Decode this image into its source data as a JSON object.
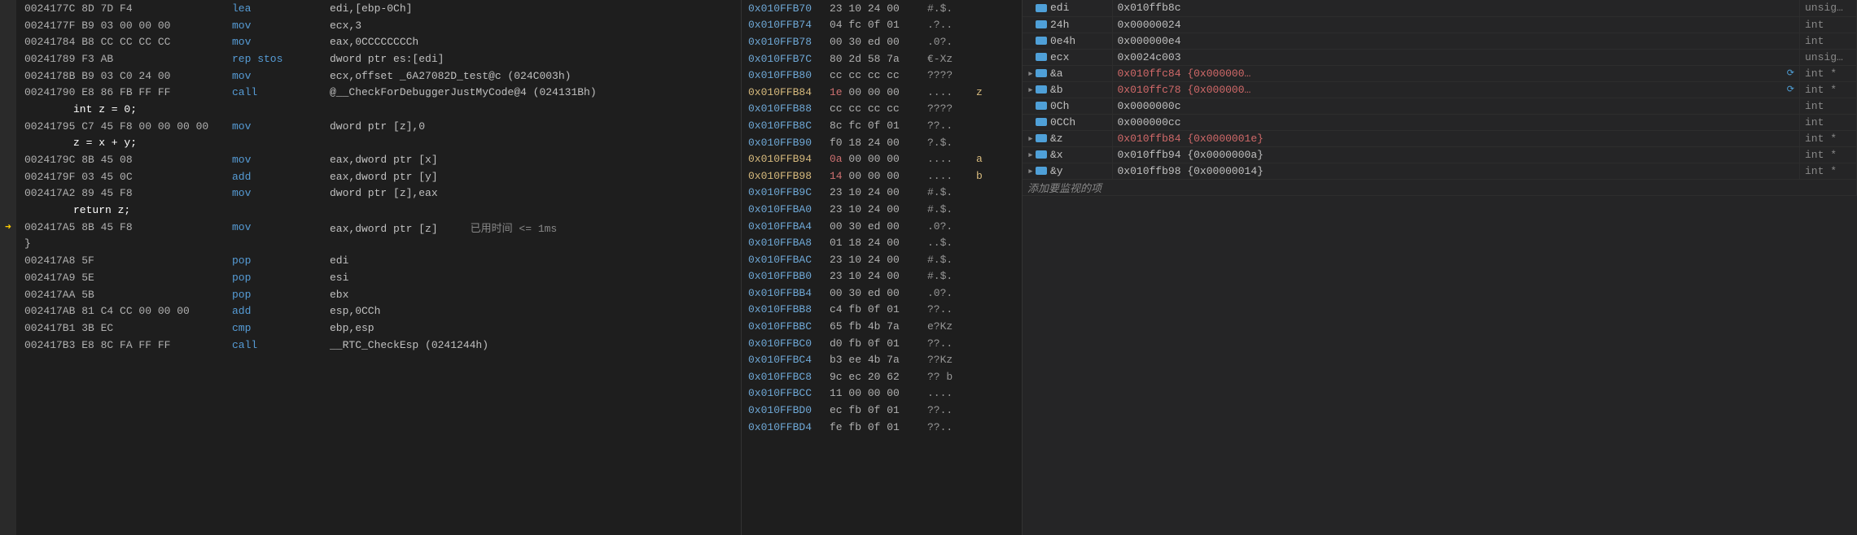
{
  "asm": [
    {
      "type": "asm",
      "addr": "0024177C 8D 7D F4",
      "op": "lea",
      "args": "edi,[ebp-0Ch]"
    },
    {
      "type": "asm",
      "addr": "0024177F B9 03 00 00 00",
      "op": "mov",
      "args": "ecx,3"
    },
    {
      "type": "asm",
      "addr": "00241784 B8 CC CC CC CC",
      "op": "mov",
      "args": "eax,0CCCCCCCCh"
    },
    {
      "type": "asm",
      "addr": "00241789 F3 AB",
      "op": "rep stos",
      "args": "dword ptr es:[edi]"
    },
    {
      "type": "asm",
      "addr": "0024178B B9 03 C0 24 00",
      "op": "mov",
      "args": "ecx,offset _6A27082D_test@c (024C003h)"
    },
    {
      "type": "asm",
      "addr": "00241790 E8 86 FB FF FF",
      "op": "call",
      "args": "@__CheckForDebuggerJustMyCode@4 (024131Bh)"
    },
    {
      "type": "src",
      "text": "int z = 0;"
    },
    {
      "type": "asm",
      "addr": "00241795 C7 45 F8 00 00 00 00",
      "op": "mov",
      "args": "dword ptr [z],0"
    },
    {
      "type": "src",
      "text": "z = x + y;"
    },
    {
      "type": "asm",
      "addr": "0024179C 8B 45 08",
      "op": "mov",
      "args": "eax,dword ptr [x]"
    },
    {
      "type": "asm",
      "addr": "0024179F 03 45 0C",
      "op": "add",
      "args": "eax,dword ptr [y]"
    },
    {
      "type": "asm",
      "addr": "002417A2 89 45 F8",
      "op": "mov",
      "args": "dword ptr [z],eax"
    },
    {
      "type": "src",
      "text": "return z;"
    },
    {
      "type": "asm",
      "addr": "002417A5 8B 45 F8",
      "op": "mov",
      "args": "eax,dword ptr [z]",
      "current": true,
      "timing": "已用时间 <= 1ms"
    },
    {
      "type": "brace",
      "text": "}"
    },
    {
      "type": "asm",
      "addr": "002417A8 5F",
      "op": "pop",
      "args": "edi"
    },
    {
      "type": "asm",
      "addr": "002417A9 5E",
      "op": "pop",
      "args": "esi"
    },
    {
      "type": "asm",
      "addr": "002417AA 5B",
      "op": "pop",
      "args": "ebx"
    },
    {
      "type": "asm",
      "addr": "002417AB 81 C4 CC 00 00 00",
      "op": "add",
      "args": "esp,0CCh"
    },
    {
      "type": "asm",
      "addr": "002417B1 3B EC",
      "op": "cmp",
      "args": "ebp,esp"
    },
    {
      "type": "asm",
      "addr": "002417B3 E8 8C FA FF FF",
      "op": "call",
      "args": "__RTC_CheckEsp (0241244h)"
    }
  ],
  "mem": [
    {
      "addr": "0x010FFB70",
      "b0": "23",
      "rest": " 10 24 00",
      "asc": "#.$."
    },
    {
      "addr": "0x010FFB74",
      "b0": "04",
      "rest": " fc 0f 01",
      "asc": ".?.."
    },
    {
      "addr": "0x010FFB78",
      "b0": "00",
      "rest": " 30 ed 00",
      "asc": ".0?."
    },
    {
      "addr": "0x010FFB7C",
      "b0": "80",
      "rest": " 2d 58 7a",
      "asc": "€-Xz"
    },
    {
      "addr": "0x010FFB80",
      "b0": "cc",
      "rest": " cc cc cc",
      "asc": "????"
    },
    {
      "addr": "0x010FFB84",
      "b0": "1e",
      "rest": " 00 00 00",
      "asc": "....",
      "var": "z",
      "hi": true
    },
    {
      "addr": "0x010FFB88",
      "b0": "cc",
      "rest": " cc cc cc",
      "asc": "????"
    },
    {
      "addr": "0x010FFB8C",
      "b0": "8c",
      "rest": " fc 0f 01",
      "asc": "??.."
    },
    {
      "addr": "0x010FFB90",
      "b0": "f0",
      "rest": " 18 24 00",
      "asc": "?.$."
    },
    {
      "addr": "0x010FFB94",
      "b0": "0a",
      "rest": " 00 00 00",
      "asc": "....",
      "var": "a",
      "hi": true
    },
    {
      "addr": "0x010FFB98",
      "b0": "14",
      "rest": " 00 00 00",
      "asc": "....",
      "var": "b",
      "hi": true
    },
    {
      "addr": "0x010FFB9C",
      "b0": "23",
      "rest": " 10 24 00",
      "asc": "#.$."
    },
    {
      "addr": "0x010FFBA0",
      "b0": "23",
      "rest": " 10 24 00",
      "asc": "#.$."
    },
    {
      "addr": "0x010FFBA4",
      "b0": "00",
      "rest": " 30 ed 00",
      "asc": ".0?."
    },
    {
      "addr": "0x010FFBA8",
      "b0": "01",
      "rest": " 18 24 00",
      "asc": "..$."
    },
    {
      "addr": "0x010FFBAC",
      "b0": "23",
      "rest": " 10 24 00",
      "asc": "#.$."
    },
    {
      "addr": "0x010FFBB0",
      "b0": "23",
      "rest": " 10 24 00",
      "asc": "#.$."
    },
    {
      "addr": "0x010FFBB4",
      "b0": "00",
      "rest": " 30 ed 00",
      "asc": ".0?."
    },
    {
      "addr": "0x010FFBB8",
      "b0": "c4",
      "rest": " fb 0f 01",
      "asc": "??.."
    },
    {
      "addr": "0x010FFBBC",
      "b0": "65",
      "rest": " fb 4b 7a",
      "asc": "e?Kz"
    },
    {
      "addr": "0x010FFBC0",
      "b0": "d0",
      "rest": " fb 0f 01",
      "asc": "??.."
    },
    {
      "addr": "0x010FFBC4",
      "b0": "b3",
      "rest": " ee 4b 7a",
      "asc": "??Kz"
    },
    {
      "addr": "0x010FFBC8",
      "b0": "9c",
      "rest": " ec 20 62",
      "asc": "?? b"
    },
    {
      "addr": "0x010FFBCC",
      "b0": "11",
      "rest": " 00 00 00",
      "asc": "...."
    },
    {
      "addr": "0x010FFBD0",
      "b0": "ec",
      "rest": " fb 0f 01",
      "asc": "??.."
    },
    {
      "addr": "0x010FFBD4",
      "b0": "fe",
      "rest": " fb 0f 01",
      "asc": "??.."
    }
  ],
  "watch": [
    {
      "exp": "",
      "name": "edi",
      "val": "0x010ffb8c",
      "type": "unsig…"
    },
    {
      "exp": "",
      "name": "24h",
      "val": "0x00000024",
      "type": "int"
    },
    {
      "exp": "",
      "name": "0e4h",
      "val": "0x000000e4",
      "type": "int"
    },
    {
      "exp": "",
      "name": "ecx",
      "val": "0x0024c003",
      "type": "unsig…"
    },
    {
      "exp": "▸",
      "name": "&a",
      "val": "0x010ffc84 {0x000000…",
      "type": "int *",
      "changed": true,
      "refresh": true
    },
    {
      "exp": "▸",
      "name": "&b",
      "val": "0x010ffc78 {0x000000…",
      "type": "int *",
      "changed": true,
      "refresh": true
    },
    {
      "exp": "",
      "name": "0Ch",
      "val": "0x0000000c",
      "type": "int"
    },
    {
      "exp": "",
      "name": "0CCh",
      "val": "0x000000cc",
      "type": "int"
    },
    {
      "exp": "▸",
      "name": "&z",
      "val": "0x010ffb84 {0x0000001e}",
      "type": "int *",
      "changed": true
    },
    {
      "exp": "▸",
      "name": "&x",
      "val": "0x010ffb94 {0x0000000a}",
      "type": "int *"
    },
    {
      "exp": "▸",
      "name": "&y",
      "val": "0x010ffb98 {0x00000014}",
      "type": "int *"
    }
  ],
  "watchAddRow": "添加要监视的项"
}
